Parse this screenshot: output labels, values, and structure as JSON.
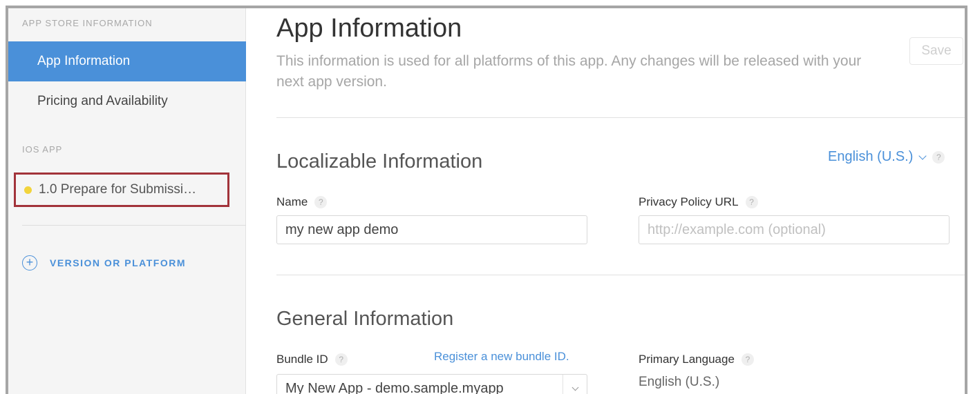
{
  "sidebar": {
    "app_store_section": "APP STORE INFORMATION",
    "items": [
      {
        "label": "App Information"
      },
      {
        "label": "Pricing and Availability"
      }
    ],
    "ios_section": "iOS APP",
    "version_item": {
      "label": "1.0 Prepare for Submissi…",
      "status_color": "#f2d43c"
    },
    "add_platform_label": "VERSION OR PLATFORM",
    "add_icon": "plus-circle-icon"
  },
  "main": {
    "title": "App Information",
    "description": "This information is used for all platforms of this app. Any changes will be released with your next app version.",
    "save_label": "Save",
    "localizable": {
      "heading": "Localizable Information",
      "language": "English (U.S.)",
      "name_label": "Name",
      "name_value": "my new app demo",
      "privacy_label": "Privacy Policy URL",
      "privacy_placeholder": "http://example.com (optional)"
    },
    "general": {
      "heading": "General Information",
      "bundle_label": "Bundle ID",
      "register_link": "Register a new bundle ID.",
      "bundle_value": "My New App - demo.sample.myapp",
      "primary_language_label": "Primary Language",
      "primary_language_value": "English (U.S.)"
    },
    "help_glyph": "?"
  },
  "colors": {
    "accent": "#4a90d9",
    "highlight_border": "#a2333a"
  }
}
